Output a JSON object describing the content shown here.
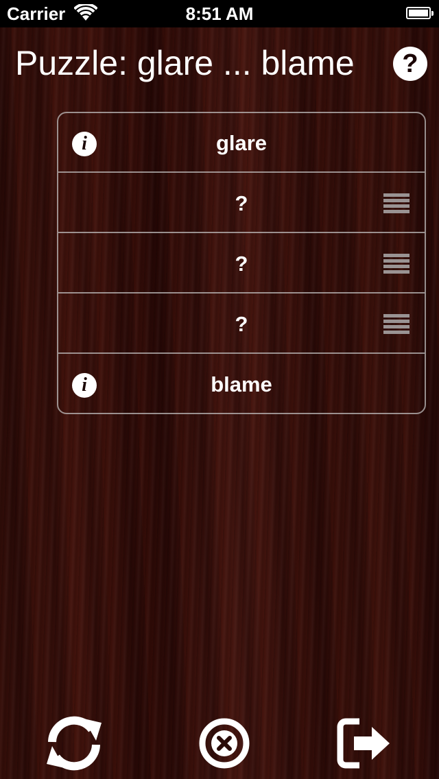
{
  "status_bar": {
    "carrier": "Carrier",
    "time": "8:51 AM"
  },
  "header": {
    "title": "Puzzle: glare ... blame",
    "help_icon": "question-circle-icon",
    "help_label": "?"
  },
  "rows": [
    {
      "word": "glare",
      "fixed": true,
      "info_label": "i"
    },
    {
      "word": "?",
      "fixed": false
    },
    {
      "word": "?",
      "fixed": false
    },
    {
      "word": "?",
      "fixed": false
    },
    {
      "word": "blame",
      "fixed": true,
      "info_label": "i"
    }
  ],
  "toolbar": {
    "refresh_icon": "refresh-icon",
    "clear_icon": "close-circle-icon",
    "exit_icon": "exit-icon"
  },
  "colors": {
    "accent": "#ffffff",
    "divider": "#c8c8c8"
  }
}
